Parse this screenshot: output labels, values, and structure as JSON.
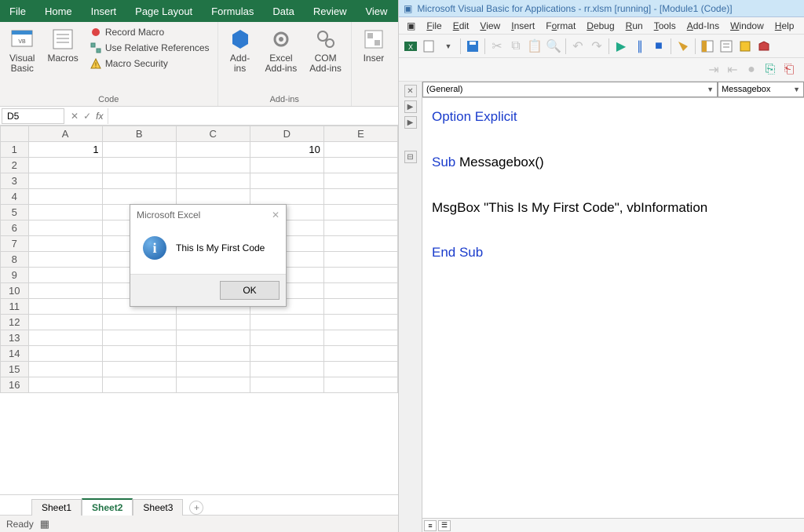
{
  "excel": {
    "tabs": [
      "File",
      "Home",
      "Insert",
      "Page Layout",
      "Formulas",
      "Data",
      "Review",
      "View"
    ],
    "ribbon": {
      "group1": {
        "visual_basic": "Visual\nBasic",
        "macros": "Macros",
        "record_macro": "Record Macro",
        "use_relative": "Use Relative References",
        "macro_security": "Macro Security",
        "label": "Code"
      },
      "group2": {
        "addins": "Add-\nins",
        "excel_addins": "Excel\nAdd-ins",
        "com_addins": "COM\nAdd-ins",
        "label": "Add-ins"
      },
      "group3": {
        "insert": "Inser"
      }
    },
    "namebox": "D5",
    "columns": [
      "A",
      "B",
      "C",
      "D",
      "E"
    ],
    "rows": [
      "1",
      "2",
      "3",
      "4",
      "5",
      "6",
      "7",
      "8",
      "9",
      "10",
      "11",
      "12",
      "13",
      "14",
      "15",
      "16"
    ],
    "cells": {
      "A1": "1",
      "D1": "10"
    },
    "sheets": [
      "Sheet1",
      "Sheet2",
      "Sheet3"
    ],
    "active_sheet": 1,
    "status": "Ready"
  },
  "msgbox": {
    "title": "Microsoft Excel",
    "text": "This Is My First Code",
    "ok": "OK"
  },
  "vba": {
    "title": "Microsoft Visual Basic for Applications - rr.xlsm [running] - [Module1 (Code)]",
    "menu": [
      "File",
      "Edit",
      "View",
      "Insert",
      "Format",
      "Debug",
      "Run",
      "Tools",
      "Add-Ins",
      "Window",
      "Help"
    ],
    "dropdown_left": "(General)",
    "dropdown_right": "Messagebox",
    "code_lines": [
      {
        "pre": "",
        "kw": "Option Explicit",
        "rest": ""
      },
      {
        "pre": "",
        "kw": "",
        "rest": ""
      },
      {
        "pre": "",
        "kw": "Sub",
        "rest": " Messagebox()"
      },
      {
        "pre": "",
        "kw": "",
        "rest": ""
      },
      {
        "pre": "MsgBox \"This Is My First Code\", vbInformation",
        "kw": "",
        "rest": ""
      },
      {
        "pre": "",
        "kw": "",
        "rest": ""
      },
      {
        "pre": "",
        "kw": "End Sub",
        "rest": ""
      }
    ]
  }
}
